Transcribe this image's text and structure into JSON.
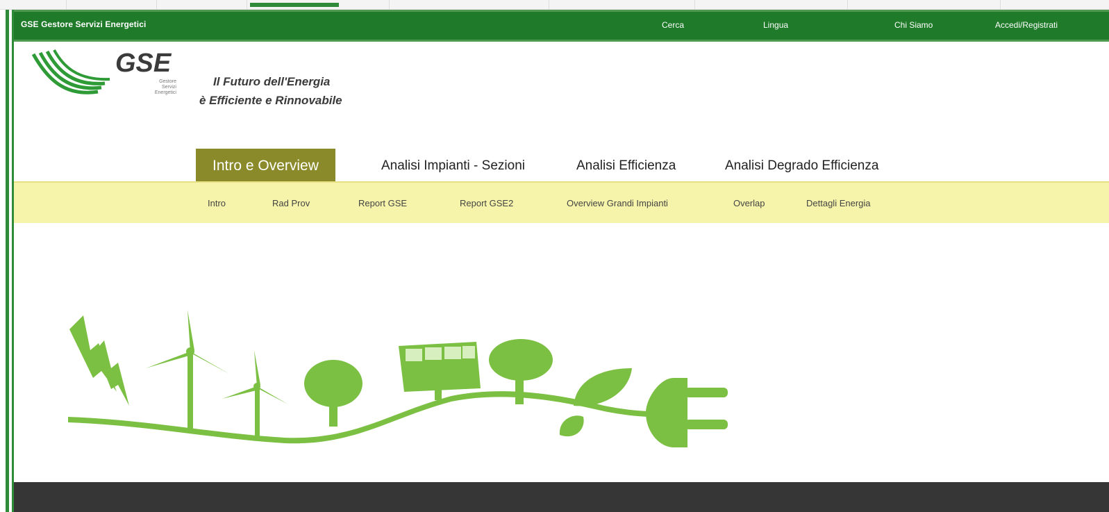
{
  "brand": {
    "text": "GSE  Gestore Servizi Energetici"
  },
  "topnav": [
    "Cerca",
    "Lingua",
    "Chi Siamo",
    "Accedi/Registrati"
  ],
  "logo": {
    "text": "GSE",
    "sub": [
      "Gestore",
      "Servizi",
      "Energetici"
    ]
  },
  "tagline": {
    "line1": "Il Futuro dell'Energia",
    "line2": "è Efficiente e Rinnovabile"
  },
  "mainnav": [
    {
      "label": "Intro e Overview",
      "active": true
    },
    {
      "label": "Analisi Impianti - Sezioni",
      "active": false
    },
    {
      "label": "Analisi Efficienza",
      "active": false
    },
    {
      "label": "Analisi Degrado Efficienza",
      "active": false
    }
  ],
  "subnav": [
    "Intro",
    "Rad Prov",
    "Report GSE",
    "Report GSE2",
    "Overview Grandi Impianti",
    "Overlap",
    "Dettagli Energia"
  ],
  "colors": {
    "topbar": "#1f7a2a",
    "active_tab": "#8a8a2a",
    "subnav_bg": "#f6f4aa",
    "hero_green": "#7cc043",
    "footer": "#363636"
  },
  "hero": {
    "icon": "renewable-energy-illustration-icon"
  }
}
